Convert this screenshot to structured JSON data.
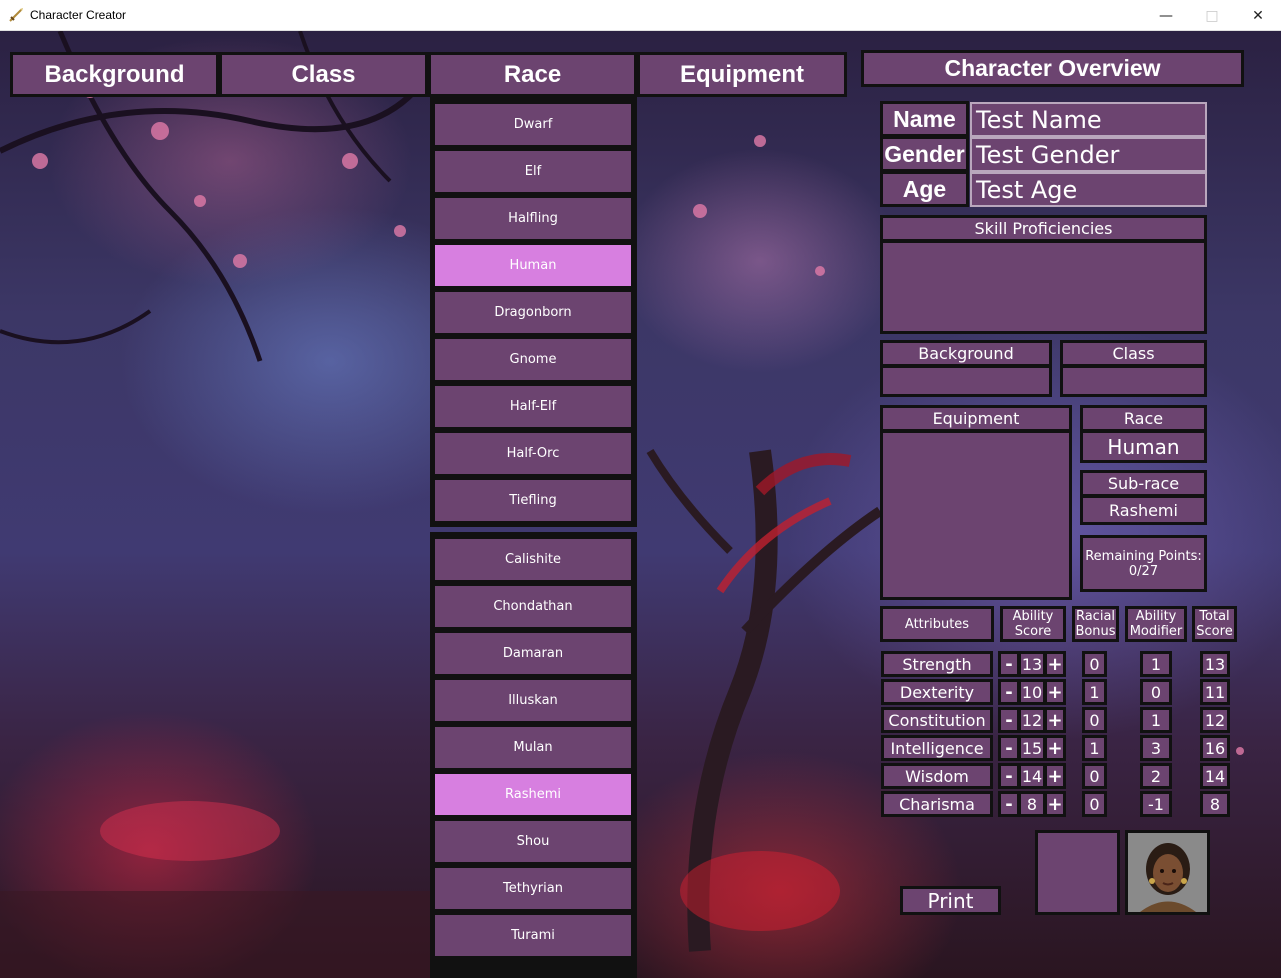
{
  "window": {
    "title": "Character Creator"
  },
  "tabs": [
    "Background",
    "Class",
    "Race",
    "Equipment"
  ],
  "races": [
    "Dwarf",
    "Elf",
    "Halfling",
    "Human",
    "Dragonborn",
    "Gnome",
    "Half-Elf",
    "Half-Orc",
    "Tiefling"
  ],
  "selected_race": "Human",
  "subraces": [
    "Calishite",
    "Chondathan",
    "Damaran",
    "Illuskan",
    "Mulan",
    "Rashemi",
    "Shou",
    "Tethyrian",
    "Turami"
  ],
  "selected_subrace": "Rashemi",
  "overview": {
    "title": "Character Overview",
    "name_label": "Name",
    "name_value": "Test Name",
    "gender_label": "Gender",
    "gender_value": "Test Gender",
    "age_label": "Age",
    "age_value": "Test Age",
    "skills_label": "Skill Proficiencies",
    "background_label": "Background",
    "background_value": "",
    "class_label": "Class",
    "class_value": "",
    "equipment_label": "Equipment",
    "race_label": "Race",
    "race_value": "Human",
    "subrace_label": "Sub-race",
    "subrace_value": "Rashemi",
    "remaining_label": "Remaining Points:",
    "remaining_value": "0/27",
    "print_label": "Print"
  },
  "attr_headers": {
    "attributes": "Attributes",
    "ability_score": [
      "Ability",
      "Score"
    ],
    "racial_bonus": [
      "Racial",
      "Bonus"
    ],
    "ability_modifier": [
      "Ability",
      "Modifier"
    ],
    "total_score": [
      "Total",
      "Score"
    ]
  },
  "controls": {
    "minus": "-",
    "plus": "+"
  },
  "attributes": [
    {
      "name": "Strength",
      "score": "13",
      "bonus": "0",
      "modifier": "1",
      "total": "13"
    },
    {
      "name": "Dexterity",
      "score": "10",
      "bonus": "1",
      "modifier": "0",
      "total": "11"
    },
    {
      "name": "Constitution",
      "score": "12",
      "bonus": "0",
      "modifier": "1",
      "total": "12"
    },
    {
      "name": "Intelligence",
      "score": "15",
      "bonus": "1",
      "modifier": "3",
      "total": "16"
    },
    {
      "name": "Wisdom",
      "score": "14",
      "bonus": "0",
      "modifier": "2",
      "total": "14"
    },
    {
      "name": "Charisma",
      "score": "8",
      "bonus": "0",
      "modifier": "-1",
      "total": "8"
    }
  ],
  "colors": {
    "panel": "#6c4470",
    "selected": "#d77fe0",
    "border": "#111111"
  },
  "icons": {
    "app": "sword-icon",
    "minimize": "minimize-icon",
    "maximize": "maximize-icon",
    "close": "close-icon",
    "portrait": "character-portrait"
  }
}
